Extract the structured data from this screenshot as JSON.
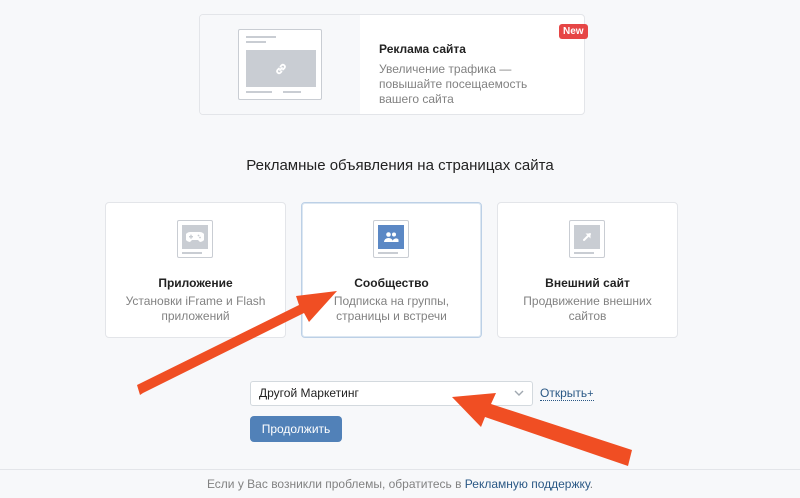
{
  "top_card": {
    "title": "Реклама сайта",
    "description": "Увеличение трафика — повышайте посещаемость вашего сайта",
    "badge": "New",
    "icon": "link-icon"
  },
  "section_heading": "Рекламные объявления на страницах сайта",
  "ad_types": [
    {
      "title": "Приложение",
      "description": "Установки iFrame и Flash приложений",
      "icon": "gamepad-icon",
      "selected": false
    },
    {
      "title": "Сообщество",
      "description": "Подписка на группы, страницы и встречи",
      "icon": "people-icon",
      "selected": true
    },
    {
      "title": "Внешний сайт",
      "description": "Продвижение внешних сайтов",
      "icon": "external-arrow-icon",
      "selected": false
    }
  ],
  "community_select": {
    "value": "Другой Маркетинг"
  },
  "open_link": {
    "label": "Открыть",
    "suffix": "+"
  },
  "continue_button": "Продолжить",
  "footer": {
    "prefix": "Если у Вас возникли проблемы, обратитесь в ",
    "link": "Рекламную поддержку",
    "suffix": "."
  },
  "colors": {
    "accent": "#5181b8",
    "link": "#2a5885",
    "badge": "#e64646",
    "annotation_arrow": "#f04e23"
  }
}
